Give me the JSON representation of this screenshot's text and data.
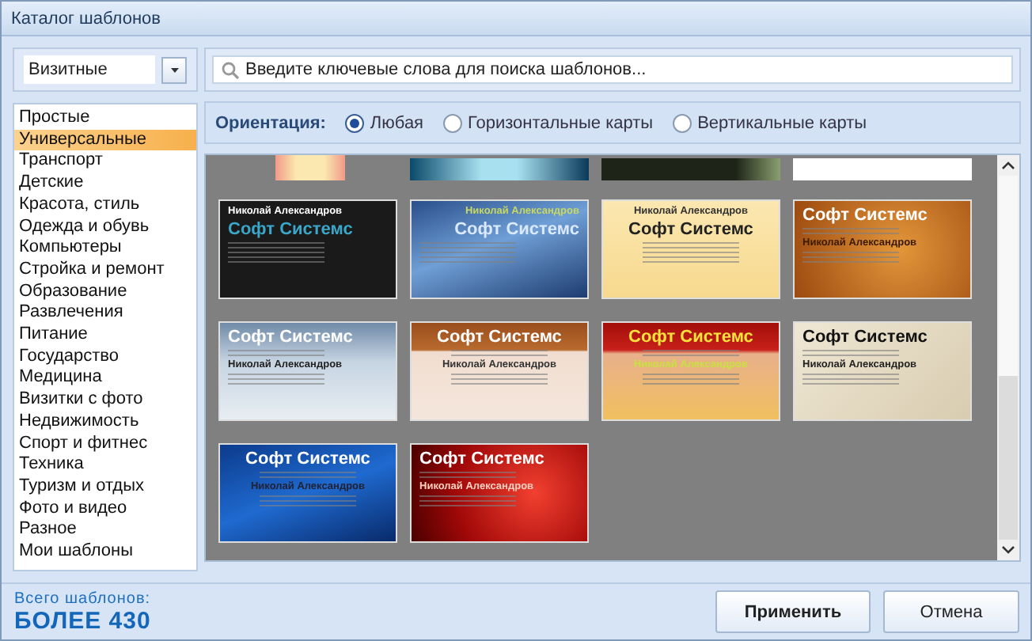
{
  "window": {
    "title": "Каталог шаблонов"
  },
  "category_select": {
    "value": "Визитные"
  },
  "search": {
    "placeholder": "Введите ключевые слова для поиска шаблонов..."
  },
  "sidebar": {
    "items": [
      {
        "label": "Простые",
        "selected": false
      },
      {
        "label": "Универсальные",
        "selected": true
      },
      {
        "label": "Транспорт",
        "selected": false
      },
      {
        "label": "Детские",
        "selected": false
      },
      {
        "label": "Красота, стиль",
        "selected": false
      },
      {
        "label": "Одежда и обувь",
        "selected": false
      },
      {
        "label": "Компьютеры",
        "selected": false
      },
      {
        "label": "Стройка и ремонт",
        "selected": false
      },
      {
        "label": "Образование",
        "selected": false
      },
      {
        "label": "Развлечения",
        "selected": false
      },
      {
        "label": "Питание",
        "selected": false
      },
      {
        "label": "Государство",
        "selected": false
      },
      {
        "label": "Медицина",
        "selected": false
      },
      {
        "label": "Визитки с фото",
        "selected": false
      },
      {
        "label": "Недвижимость",
        "selected": false
      },
      {
        "label": "Спорт и фитнес",
        "selected": false
      },
      {
        "label": "Техника",
        "selected": false
      },
      {
        "label": "Туризм и отдых",
        "selected": false
      },
      {
        "label": "Фото и видео",
        "selected": false
      },
      {
        "label": "Разное",
        "selected": false
      },
      {
        "label": "Мои шаблоны",
        "selected": false
      }
    ]
  },
  "orientation": {
    "label": "Ориентация:",
    "options": [
      {
        "label": "Любая",
        "selected": true
      },
      {
        "label": "Горизонтальные карты",
        "selected": false
      },
      {
        "label": "Вертикальные карты",
        "selected": false
      }
    ]
  },
  "partial_row": [
    {
      "kind": "floral"
    },
    {
      "kind": "teal"
    },
    {
      "kind": "darkgreen"
    },
    {
      "kind": "white"
    }
  ],
  "templates": [
    {
      "kind": "dark",
      "company": "Софт Системс",
      "person": "Николай Александров"
    },
    {
      "kind": "bluewave",
      "company": "Софт Системс",
      "person": "Николай Александров"
    },
    {
      "kind": "cream",
      "company": "Софт Системс",
      "person": "Николай Александров"
    },
    {
      "kind": "orange",
      "company": "Софт Системс",
      "person": "Николай Александров"
    },
    {
      "kind": "steel",
      "company": "Софт Системс",
      "person": "Николай Александров"
    },
    {
      "kind": "wood",
      "company": "Софт Системс",
      "person": "Николай Александров"
    },
    {
      "kind": "redgold",
      "company": "Софт Системс",
      "person": "Николай Александров"
    },
    {
      "kind": "ink",
      "company": "Софт Системс",
      "person": "Николай Александров"
    },
    {
      "kind": "bluelight",
      "company": "Софт Системс",
      "person": "Николай Александров"
    },
    {
      "kind": "redwave",
      "company": "Софт Системс",
      "person": "Николай Александров"
    }
  ],
  "footer": {
    "total_label": "Всего шаблонов:",
    "total_value": "БОЛЕЕ 430"
  },
  "buttons": [
    {
      "label": "Применить",
      "kind": "primary"
    },
    {
      "label": "Отмена",
      "kind": "secondary"
    }
  ]
}
